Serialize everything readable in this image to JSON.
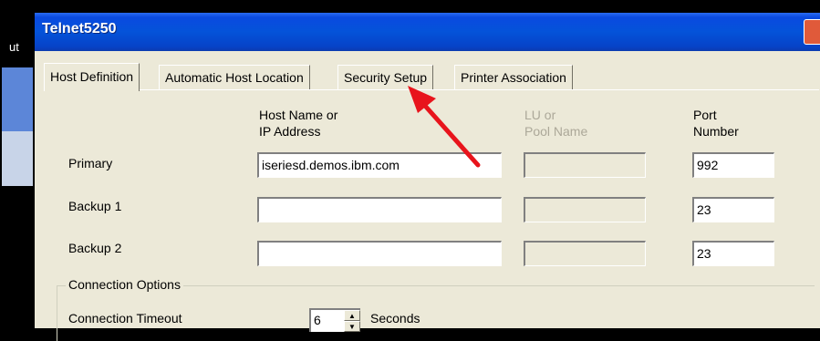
{
  "background": {
    "top_text": "",
    "left_text": "ut"
  },
  "window": {
    "title": "Telnet5250",
    "titlebar_color": "#0453d9"
  },
  "tabs": [
    {
      "label": "Host Definition",
      "active": true
    },
    {
      "label": "Automatic Host Location",
      "active": false
    },
    {
      "label": "Security Setup",
      "active": false
    },
    {
      "label": "Printer Association",
      "active": false
    }
  ],
  "columns": {
    "host_line1": "Host Name or",
    "host_line2": "IP Address",
    "lu_line1": "LU or",
    "lu_line2": "Pool Name",
    "port_line1": "Port",
    "port_line2": "Number"
  },
  "rows": [
    {
      "label": "Primary",
      "host": "iseriesd.demos.ibm.com",
      "lu": "",
      "port": "992"
    },
    {
      "label": "Backup 1",
      "host": "",
      "lu": "",
      "port": "23"
    },
    {
      "label": "Backup 2",
      "host": "",
      "lu": "",
      "port": "23"
    }
  ],
  "connection_options": {
    "legend": "Connection Options",
    "timeout_label": "Connection Timeout",
    "timeout_value": "6",
    "timeout_unit": "Seconds"
  },
  "annotation": {
    "arrow_color": "#e8141c"
  }
}
